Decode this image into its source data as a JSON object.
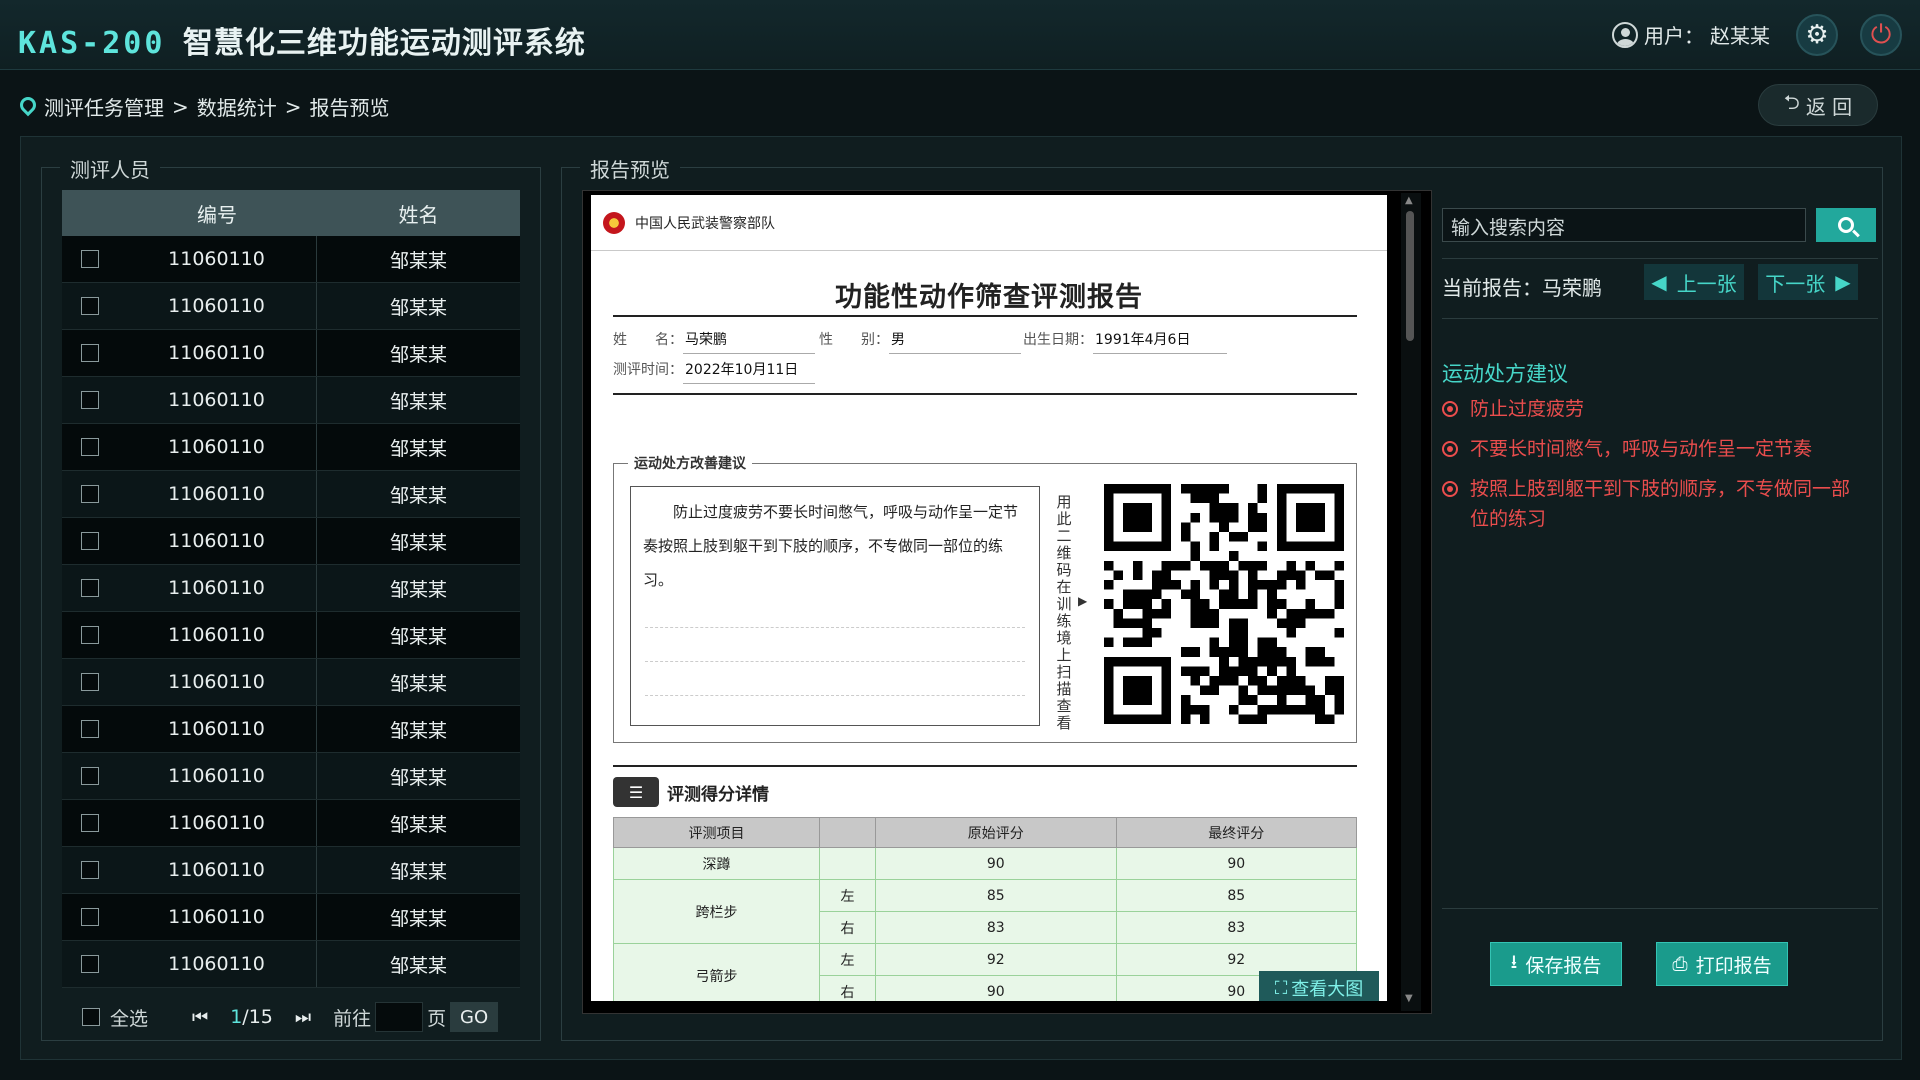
{
  "header": {
    "logo_code": "KAS-200",
    "logo_title": "智慧化三维功能运动测评系统",
    "user_label": "用户：",
    "user_name": "赵某某"
  },
  "breadcrumb": {
    "items": [
      "测评任务管理",
      "数据统计",
      "报告预览"
    ],
    "sep": ">",
    "back_label": "返 回"
  },
  "left_panel": {
    "title": "测评人员",
    "columns": [
      "编号",
      "姓名"
    ],
    "rows": [
      {
        "id": "11060110",
        "name": "邹某某"
      },
      {
        "id": "11060110",
        "name": "邹某某"
      },
      {
        "id": "11060110",
        "name": "邹某某"
      },
      {
        "id": "11060110",
        "name": "邹某某"
      },
      {
        "id": "11060110",
        "name": "邹某某"
      },
      {
        "id": "11060110",
        "name": "邹某某"
      },
      {
        "id": "11060110",
        "name": "邹某某"
      },
      {
        "id": "11060110",
        "name": "邹某某"
      },
      {
        "id": "11060110",
        "name": "邹某某"
      },
      {
        "id": "11060110",
        "name": "邹某某"
      },
      {
        "id": "11060110",
        "name": "邹某某"
      },
      {
        "id": "11060110",
        "name": "邹某某"
      },
      {
        "id": "11060110",
        "name": "邹某某"
      },
      {
        "id": "11060110",
        "name": "邹某某"
      },
      {
        "id": "11060110",
        "name": "邹某某"
      },
      {
        "id": "11060110",
        "name": "邹某某"
      }
    ],
    "select_all": "全选",
    "page_current": "1",
    "page_total": "/15",
    "goto_prefix": "前往",
    "goto_suffix": "页",
    "go_label": "GO"
  },
  "report_panel": {
    "title": "报告预览",
    "paper": {
      "org": "中国人民武装警察部队",
      "title": "功能性动作筛查评测报告",
      "name_label": "姓　　名：",
      "name_value": "马荣鹏",
      "gender_label": "性　　别：",
      "gender_value": "男",
      "birth_label": "出生日期：",
      "birth_value": "1991年4月6日",
      "test_time_label": "测评时间：",
      "test_time_value": "2022年10月11日",
      "advice_legend": "运动处方改善建议",
      "advice_text": "防止过度疲劳不要长时间憋气，呼吸与动作呈一定节奏按照上肢到躯干到下肢的顺序，不专做同一部位的练习。",
      "qr_hint": "用此二维码在训练境上扫描查看",
      "score_title": "评测得分详情",
      "score_columns": [
        "评测项目",
        "原始评分",
        "最终评分"
      ],
      "score_rows": [
        {
          "item": "深蹲",
          "side": "",
          "raw": "90",
          "final": "90"
        },
        {
          "item": "跨栏步",
          "side": "左",
          "raw": "85",
          "final": "85"
        },
        {
          "item": "",
          "side": "右",
          "raw": "83",
          "final": "83"
        },
        {
          "item": "弓箭步",
          "side": "左",
          "raw": "92",
          "final": "92"
        },
        {
          "item": "",
          "side": "右",
          "raw": "90",
          "final": "90"
        }
      ]
    },
    "view_big_label": "查看大图"
  },
  "right_panel": {
    "search_placeholder": "输入搜索内容",
    "current_label": "当前报告：",
    "current_name": "马荣鹏",
    "prev_label": "上一张",
    "next_label": "下一张",
    "rx_title": "运动处方建议",
    "rx_items": [
      "防止过度疲劳",
      "不要长时间憋气，呼吸与动作呈一定节奏",
      "按照上肢到躯干到下肢的顺序，不专做同一部位的练习"
    ],
    "save_label": "保存报告",
    "print_label": "打印报告"
  },
  "colors": {
    "accent": "#46d6c8",
    "warning": "#ea4d4d",
    "button": "#1a9b8c"
  }
}
